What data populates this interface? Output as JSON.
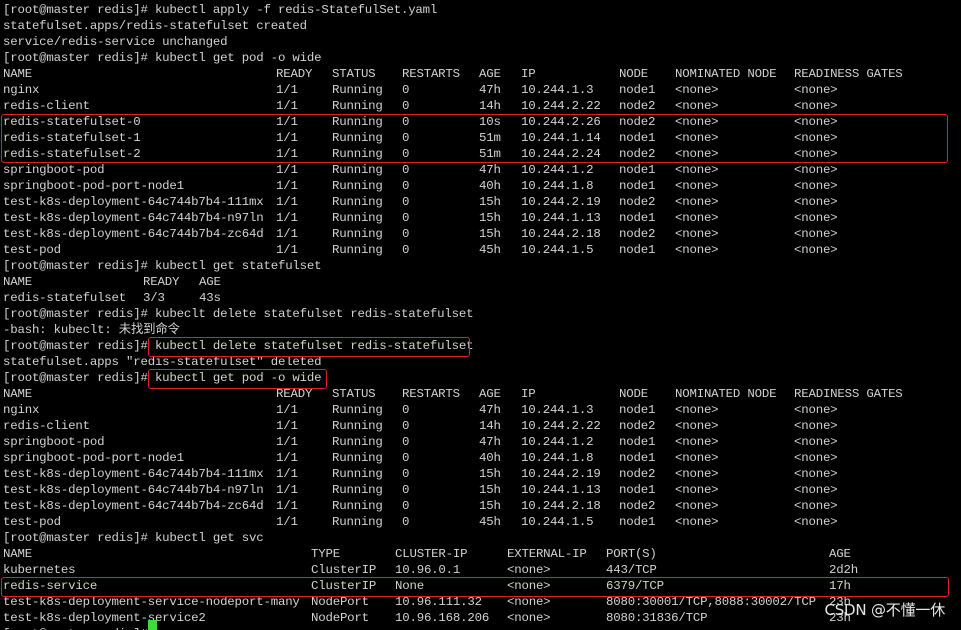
{
  "terminal": {
    "lines": [
      {
        "type": "text",
        "text": "[root@master redis]# kubectl apply -f redis-StatefulSet.yaml"
      },
      {
        "type": "text",
        "text": "statefulset.apps/redis-statefulset created"
      },
      {
        "type": "text",
        "text": "service/redis-service unchanged"
      },
      {
        "type": "text",
        "text": "[root@master redis]# kubectl get pod -o wide"
      },
      {
        "type": "row",
        "table": "pods",
        "cells": [
          "NAME",
          "READY",
          "STATUS",
          "RESTARTS",
          "AGE",
          "IP",
          "NODE",
          "NOMINATED NODE",
          "READINESS GATES"
        ]
      },
      {
        "type": "row",
        "table": "pods",
        "cells": [
          "nginx",
          "1/1",
          "Running",
          "0",
          "47h",
          "10.244.1.3",
          "node1",
          "<none>",
          "<none>"
        ]
      },
      {
        "type": "row",
        "table": "pods",
        "cells": [
          "redis-client",
          "1/1",
          "Running",
          "0",
          "14h",
          "10.244.2.22",
          "node2",
          "<none>",
          "<none>"
        ]
      },
      {
        "type": "row",
        "table": "pods",
        "cells": [
          "redis-statefulset-0",
          "1/1",
          "Running",
          "0",
          "10s",
          "10.244.2.26",
          "node2",
          "<none>",
          "<none>"
        ]
      },
      {
        "type": "row",
        "table": "pods",
        "cells": [
          "redis-statefulset-1",
          "1/1",
          "Running",
          "0",
          "51m",
          "10.244.1.14",
          "node1",
          "<none>",
          "<none>"
        ]
      },
      {
        "type": "row",
        "table": "pods",
        "cells": [
          "redis-statefulset-2",
          "1/1",
          "Running",
          "0",
          "51m",
          "10.244.2.24",
          "node2",
          "<none>",
          "<none>"
        ]
      },
      {
        "type": "row",
        "table": "pods",
        "cells": [
          "springboot-pod",
          "1/1",
          "Running",
          "0",
          "47h",
          "10.244.1.2",
          "node1",
          "<none>",
          "<none>"
        ]
      },
      {
        "type": "row",
        "table": "pods",
        "cells": [
          "springboot-pod-port-node1",
          "1/1",
          "Running",
          "0",
          "40h",
          "10.244.1.8",
          "node1",
          "<none>",
          "<none>"
        ]
      },
      {
        "type": "row",
        "table": "pods",
        "cells": [
          "test-k8s-deployment-64c744b7b4-111mx",
          "1/1",
          "Running",
          "0",
          "15h",
          "10.244.2.19",
          "node2",
          "<none>",
          "<none>"
        ]
      },
      {
        "type": "row",
        "table": "pods",
        "cells": [
          "test-k8s-deployment-64c744b7b4-n97ln",
          "1/1",
          "Running",
          "0",
          "15h",
          "10.244.1.13",
          "node1",
          "<none>",
          "<none>"
        ]
      },
      {
        "type": "row",
        "table": "pods",
        "cells": [
          "test-k8s-deployment-64c744b7b4-zc64d",
          "1/1",
          "Running",
          "0",
          "15h",
          "10.244.2.18",
          "node2",
          "<none>",
          "<none>"
        ]
      },
      {
        "type": "row",
        "table": "pods",
        "cells": [
          "test-pod",
          "1/1",
          "Running",
          "0",
          "45h",
          "10.244.1.5",
          "node1",
          "<none>",
          "<none>"
        ]
      },
      {
        "type": "text",
        "text": "[root@master redis]# kubectl get statefulset"
      },
      {
        "type": "row",
        "table": "sts",
        "cells": [
          "NAME",
          "READY",
          "AGE"
        ]
      },
      {
        "type": "row",
        "table": "sts",
        "cells": [
          "redis-statefulset",
          "3/3",
          "43s"
        ]
      },
      {
        "type": "text",
        "text": "[root@master redis]# kubeclt delete statefulset redis-statefulset"
      },
      {
        "type": "text",
        "text": "-bash: kubeclt: 未找到命令"
      },
      {
        "type": "text",
        "text": "[root@master redis]# kubectl delete statefulset redis-statefulset"
      },
      {
        "type": "text",
        "text": "statefulset.apps \"redis-statefulset\" deleted"
      },
      {
        "type": "text",
        "text": "[root@master redis]# kubectl get pod -o wide"
      },
      {
        "type": "row",
        "table": "pods",
        "cells": [
          "NAME",
          "READY",
          "STATUS",
          "RESTARTS",
          "AGE",
          "IP",
          "NODE",
          "NOMINATED NODE",
          "READINESS GATES"
        ]
      },
      {
        "type": "row",
        "table": "pods",
        "cells": [
          "nginx",
          "1/1",
          "Running",
          "0",
          "47h",
          "10.244.1.3",
          "node1",
          "<none>",
          "<none>"
        ]
      },
      {
        "type": "row",
        "table": "pods",
        "cells": [
          "redis-client",
          "1/1",
          "Running",
          "0",
          "14h",
          "10.244.2.22",
          "node2",
          "<none>",
          "<none>"
        ]
      },
      {
        "type": "row",
        "table": "pods",
        "cells": [
          "springboot-pod",
          "1/1",
          "Running",
          "0",
          "47h",
          "10.244.1.2",
          "node1",
          "<none>",
          "<none>"
        ]
      },
      {
        "type": "row",
        "table": "pods",
        "cells": [
          "springboot-pod-port-node1",
          "1/1",
          "Running",
          "0",
          "40h",
          "10.244.1.8",
          "node1",
          "<none>",
          "<none>"
        ]
      },
      {
        "type": "row",
        "table": "pods",
        "cells": [
          "test-k8s-deployment-64c744b7b4-111mx",
          "1/1",
          "Running",
          "0",
          "15h",
          "10.244.2.19",
          "node2",
          "<none>",
          "<none>"
        ]
      },
      {
        "type": "row",
        "table": "pods",
        "cells": [
          "test-k8s-deployment-64c744b7b4-n97ln",
          "1/1",
          "Running",
          "0",
          "15h",
          "10.244.1.13",
          "node1",
          "<none>",
          "<none>"
        ]
      },
      {
        "type": "row",
        "table": "pods",
        "cells": [
          "test-k8s-deployment-64c744b7b4-zc64d",
          "1/1",
          "Running",
          "0",
          "15h",
          "10.244.2.18",
          "node2",
          "<none>",
          "<none>"
        ]
      },
      {
        "type": "row",
        "table": "pods",
        "cells": [
          "test-pod",
          "1/1",
          "Running",
          "0",
          "45h",
          "10.244.1.5",
          "node1",
          "<none>",
          "<none>"
        ]
      },
      {
        "type": "text",
        "text": "[root@master redis]# kubectl get svc"
      },
      {
        "type": "row",
        "table": "svc",
        "cells": [
          "NAME",
          "TYPE",
          "CLUSTER-IP",
          "EXTERNAL-IP",
          "PORT(S)",
          "AGE"
        ]
      },
      {
        "type": "row",
        "table": "svc",
        "cells": [
          "kubernetes",
          "ClusterIP",
          "10.96.0.1",
          "<none>",
          "443/TCP",
          "2d2h"
        ]
      },
      {
        "type": "row",
        "table": "svc",
        "cells": [
          "redis-service",
          "ClusterIP",
          "None",
          "<none>",
          "6379/TCP",
          "17h"
        ]
      },
      {
        "type": "row",
        "table": "svc",
        "cells": [
          "test-k8s-deployment-service-nodeport-many",
          "NodePort",
          "10.96.111.32",
          "<none>",
          "8080:30001/TCP,8088:30002/TCP",
          "23h"
        ]
      },
      {
        "type": "row",
        "table": "svc",
        "cells": [
          "test-k8s-deployment-service2",
          "NodePort",
          "10.96.168.206",
          "<none>",
          "8080:31836/TCP",
          "23h"
        ]
      },
      {
        "type": "text",
        "text": "[root@master redis]# "
      }
    ],
    "highlight_color": "#d8232a",
    "cursor_color": "#3bdc3b"
  },
  "watermark": "CSDN @不懂一休"
}
